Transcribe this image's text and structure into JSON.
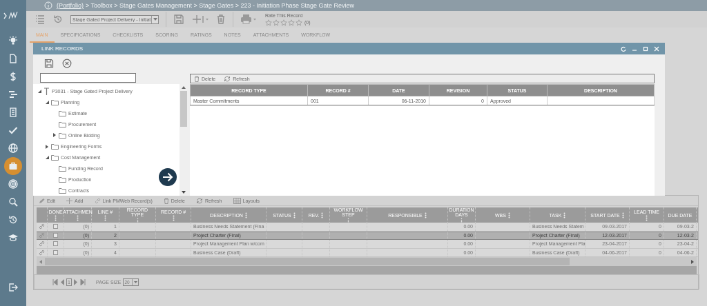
{
  "sidebar": {
    "items": [
      {
        "kind": "bulb",
        "selected": false
      },
      {
        "kind": "document",
        "selected": false
      },
      {
        "kind": "dollar",
        "selected": false
      },
      {
        "kind": "bars",
        "selected": false
      },
      {
        "kind": "building",
        "selected": false
      },
      {
        "kind": "check",
        "selected": false
      },
      {
        "kind": "globe",
        "selected": false
      },
      {
        "kind": "briefcase",
        "selected": true
      },
      {
        "kind": "fingerprint",
        "selected": false
      },
      {
        "kind": "search",
        "selected": false
      },
      {
        "kind": "history",
        "selected": false
      },
      {
        "kind": "cap",
        "selected": false
      },
      {
        "kind": "logout",
        "selected": false
      }
    ]
  },
  "breadcrumb": {
    "link": "(Portfolio)",
    "path": "> Toolbox > Stage Gates Management > Stage Gates > 223 - Initiation Phase Stage Gate Review"
  },
  "toolbar": {
    "view_select": "Stage Gated Project Delivery - Initiat",
    "rating": {
      "label": "Rate This Record",
      "stars": 0,
      "count": "(0)"
    }
  },
  "tabs": [
    {
      "label": "MAIN",
      "selected": true
    },
    {
      "label": "SPECIFICATIONS",
      "selected": false
    },
    {
      "label": "CHECKLISTS",
      "selected": false
    },
    {
      "label": "SCORING",
      "selected": false
    },
    {
      "label": "RATINGS",
      "selected": false
    },
    {
      "label": "NOTES",
      "selected": false
    },
    {
      "label": "ATTACHMENTS",
      "selected": false
    },
    {
      "label": "WORKFLOW",
      "selected": false
    }
  ],
  "dialog": {
    "title": "LINK RECORDS",
    "tree": [
      {
        "label": "P3031 - Stage Gated Project Delivery",
        "kind": "project",
        "expanded": true,
        "children": [
          {
            "label": "Planning",
            "kind": "folder",
            "expanded": true,
            "children": [
              {
                "label": "Estimate",
                "kind": "folder"
              },
              {
                "label": "Procurement",
                "kind": "folder"
              },
              {
                "label": "Online Bidding",
                "kind": "folder",
                "expanded": false
              }
            ]
          },
          {
            "label": "Engineering Forms",
            "kind": "folder",
            "expanded": false
          },
          {
            "label": "Cost Management",
            "kind": "folder",
            "expanded": true,
            "children": [
              {
                "label": "Funding Record",
                "kind": "folder"
              },
              {
                "label": "Production",
                "kind": "folder"
              },
              {
                "label": "Contracts",
                "kind": "folder"
              }
            ]
          }
        ]
      }
    ],
    "toolbar": [
      {
        "label": "Delete",
        "kind": "delete"
      },
      {
        "label": "Refresh",
        "kind": "refresh"
      }
    ],
    "table": {
      "columns": [
        "RECORD TYPE",
        "RECORD #",
        "DATE",
        "REVISION",
        "STATUS",
        "DESCRIPTION"
      ],
      "rows": [
        {
          "cells": [
            "Master Commitments",
            "001",
            "06-11-2010",
            "0",
            "Approved",
            null
          ]
        }
      ]
    }
  },
  "grid": {
    "toolbar": [
      {
        "label": "Edit",
        "kind": "edit"
      },
      {
        "label": "Add",
        "kind": "add"
      },
      {
        "label": "Link PMWeb Record(s)",
        "kind": "link"
      },
      {
        "label": "Delete",
        "kind": "delete"
      },
      {
        "label": "Refresh",
        "kind": "refresh"
      },
      {
        "label": "Layouts",
        "kind": "layouts"
      }
    ],
    "columns": [
      "DONE",
      "ATTACHMEN",
      "LINE #",
      "RECORD TYPE",
      "RECORD #",
      "DESCRIPTION",
      "STATUS",
      "REV.",
      "WORKFLOW STEP",
      "RESPONSIBLE",
      "DURATION DAYS",
      "WBS",
      "TASK",
      "START DATE",
      "LEAD TIME",
      "DUE DATE"
    ],
    "rows": [
      {
        "selected": false,
        "checked": false,
        "attachments": "(0)",
        "line": "1",
        "description": "Business Needs Statement (Fina",
        "duration": "0.00",
        "task": "Business Needs Statem",
        "start_date": "09-03-2017",
        "lead_time": "0",
        "due_date": "09-03-2"
      },
      {
        "selected": true,
        "checked": false,
        "attachments": "(0)",
        "line": "2",
        "description": "Project Charter (Final)",
        "duration": "0.00",
        "task": "Project Charter (Final)",
        "start_date": "12-03-2017",
        "lead_time": "0",
        "due_date": "12-03-2"
      },
      {
        "selected": false,
        "checked": false,
        "attachments": "(0)",
        "line": "3",
        "description": "Project Management Plan w/com",
        "duration": "0.00",
        "task": "Project Management Pla",
        "start_date": "23-04-2017",
        "lead_time": "0",
        "due_date": "23-04-2"
      },
      {
        "selected": false,
        "checked": false,
        "attachments": "(0)",
        "line": "4",
        "description": "Business Case (Draft)",
        "duration": "0.00",
        "task": "Business Case (Draft)",
        "start_date": "04-06-2017",
        "lead_time": "0",
        "due_date": "04-06-2"
      }
    ]
  },
  "pager": {
    "page": "1",
    "page_size_label": "PAGE SIZE",
    "page_size": "20"
  }
}
